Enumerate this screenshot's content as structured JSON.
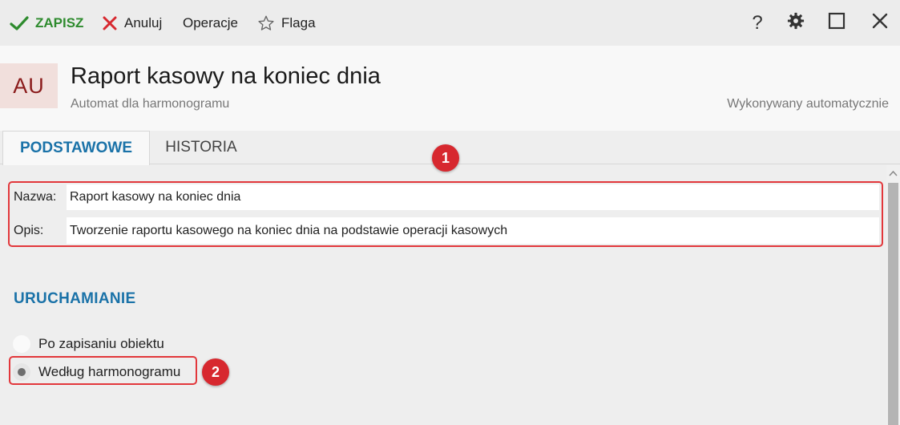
{
  "toolbar": {
    "save_label": "ZAPISZ",
    "cancel_label": "Anuluj",
    "operations_label": "Operacje",
    "flag_label": "Flaga",
    "help_label": "?"
  },
  "header": {
    "avatar_text": "AU",
    "title": "Raport kasowy na koniec dnia",
    "subtitle": "Automat dla harmonogramu",
    "execution_mode": "Wykonywany automatycznie"
  },
  "tabs": [
    {
      "label": "PODSTAWOWE",
      "active": true
    },
    {
      "label": "HISTORIA",
      "active": false
    }
  ],
  "form": {
    "name_label": "Nazwa:",
    "name_value": "Raport kasowy na koniec dnia",
    "description_label": "Opis:",
    "description_value": "Tworzenie raportu kasowego na koniec dnia na podstawie operacji kasowych"
  },
  "launch": {
    "section_title": "URUCHAMIANIE",
    "options": [
      {
        "label": "Po zapisaniu obiektu",
        "selected": false
      },
      {
        "label": "Według harmonogramu",
        "selected": true
      }
    ]
  },
  "annotations": {
    "badge_1": "1",
    "badge_2": "2"
  },
  "colors": {
    "accent_blue": "#1a72a8",
    "save_green": "#2e8b2e",
    "cancel_red": "#d7282f",
    "highlight_red": "#e2373b",
    "avatar_bg": "#f1dfdc",
    "avatar_text": "#8a1b1b"
  },
  "icons": {
    "save": "checkmark-icon",
    "cancel": "x-icon",
    "flag": "star-outline-icon",
    "help": "question-icon",
    "settings": "gear-icon",
    "maximize": "square-icon",
    "close": "close-icon",
    "scroll_up": "chevron-up-icon"
  }
}
